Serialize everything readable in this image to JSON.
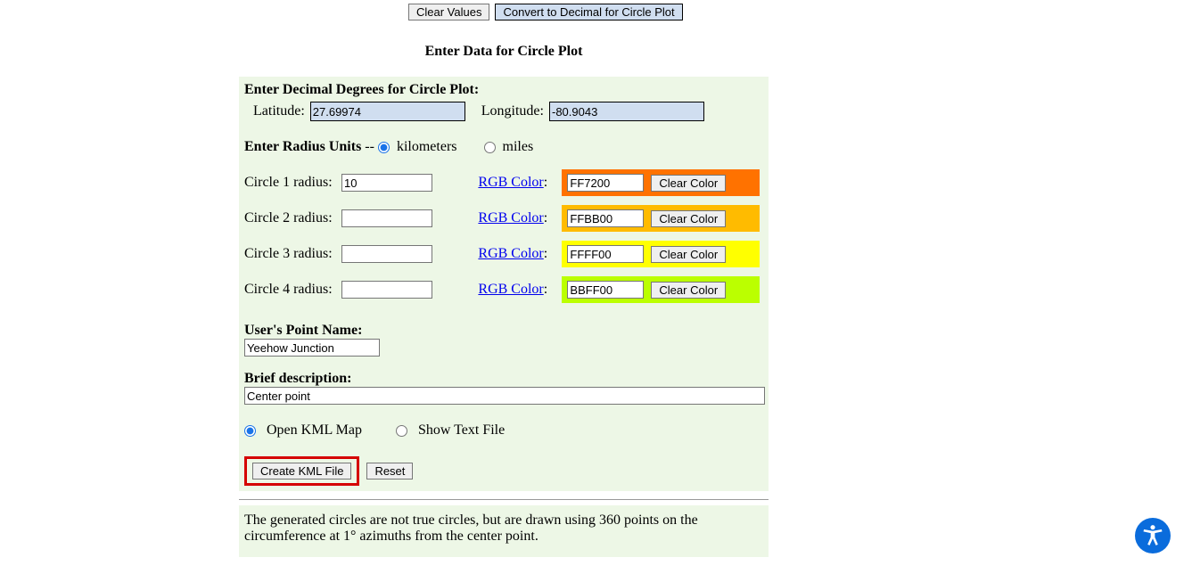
{
  "top": {
    "clear_values": "Clear Values",
    "convert_decimal": "Convert to Decimal for Circle Plot"
  },
  "heading": "Enter Data for Circle Plot",
  "form": {
    "dec_deg_label": "Enter Decimal Degrees for Circle Plot:",
    "lat_label": "Latitude:",
    "lat_value": "27.69974",
    "lon_label": "Longitude:",
    "lon_value": "-80.9043",
    "radius_units_label": "Enter Radius Units",
    "dashdash": " -- ",
    "unit_km": "kilometers",
    "unit_mi": "miles",
    "circles": [
      {
        "label": "Circle 1 radius:",
        "radius": "10",
        "rgb_link": "RGB Color",
        "color": "FF7200",
        "clear": "Clear Color",
        "bg": "#FF7200"
      },
      {
        "label": "Circle 2 radius:",
        "radius": "",
        "rgb_link": "RGB Color",
        "color": "FFBB00",
        "clear": "Clear Color",
        "bg": "#FFBB00"
      },
      {
        "label": "Circle 3 radius:",
        "radius": "",
        "rgb_link": "RGB Color",
        "color": "FFFF00",
        "clear": "Clear Color",
        "bg": "#FFFF00"
      },
      {
        "label": "Circle 4 radius:",
        "radius": "",
        "rgb_link": "RGB Color",
        "color": "BBFF00",
        "clear": "Clear Color",
        "bg": "#BBFF00"
      }
    ],
    "point_name_label": "User's Point Name:",
    "point_name_value": "Yeehow Junction",
    "desc_label": "Brief description:",
    "desc_value": "Center point",
    "open_kml": "Open KML Map",
    "show_text": "Show Text File",
    "create_kml": "Create KML File",
    "reset": "Reset"
  },
  "footer_note": "The generated circles are not true circles, but are drawn using 360 points on the circumference at 1° azimuths from the center point."
}
